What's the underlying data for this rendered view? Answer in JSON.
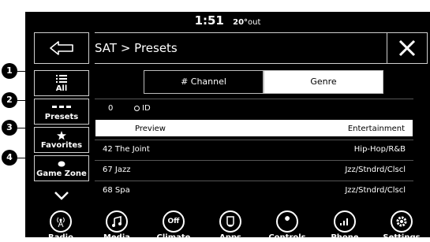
{
  "status": {
    "time": "1:51",
    "temp": "20°",
    "temp_unit": "out"
  },
  "header": {
    "title": "SAT > Presets"
  },
  "sidebar": {
    "items": [
      {
        "label": "All",
        "icon": "list-icon",
        "callout": "1"
      },
      {
        "label": "Presets",
        "icon": "presets-icon",
        "callout": "2"
      },
      {
        "label": "Favorites",
        "icon": "star-icon",
        "callout": "3"
      },
      {
        "label": "Game Zone",
        "icon": "football-icon",
        "callout": "4"
      }
    ]
  },
  "tabs": [
    {
      "label": "# Channel",
      "active": true
    },
    {
      "label": "Genre",
      "active": false
    }
  ],
  "list": [
    {
      "channel": "0",
      "name": "ID",
      "genre": ""
    },
    {
      "channel": "",
      "name": "Preview",
      "genre": "Entertainment"
    },
    {
      "channel": "42",
      "name": "The Joint",
      "genre": "Hip-Hop/R&B"
    },
    {
      "channel": "67",
      "name": "Jazz",
      "genre": "Jzz/Stndrd/Clscl"
    },
    {
      "channel": "68",
      "name": "Spa",
      "genre": "Jzz/Stndrd/Clscl"
    }
  ],
  "bottombar": [
    {
      "label": "Radio",
      "icon": "radio-icon"
    },
    {
      "label": "Media",
      "icon": "music-note-icon"
    },
    {
      "label": "Climate",
      "icon": "climate-icon",
      "glyph": "Off"
    },
    {
      "label": "Apps",
      "icon": "apps-icon"
    },
    {
      "label": "Controls",
      "icon": "wrench-icon"
    },
    {
      "label": "Phone",
      "icon": "phone-signal-icon"
    },
    {
      "label": "Settings",
      "icon": "gear-icon"
    }
  ],
  "colors": {
    "background": "#000000",
    "foreground": "#ffffff",
    "tab_active_fill": "#ffffff"
  }
}
